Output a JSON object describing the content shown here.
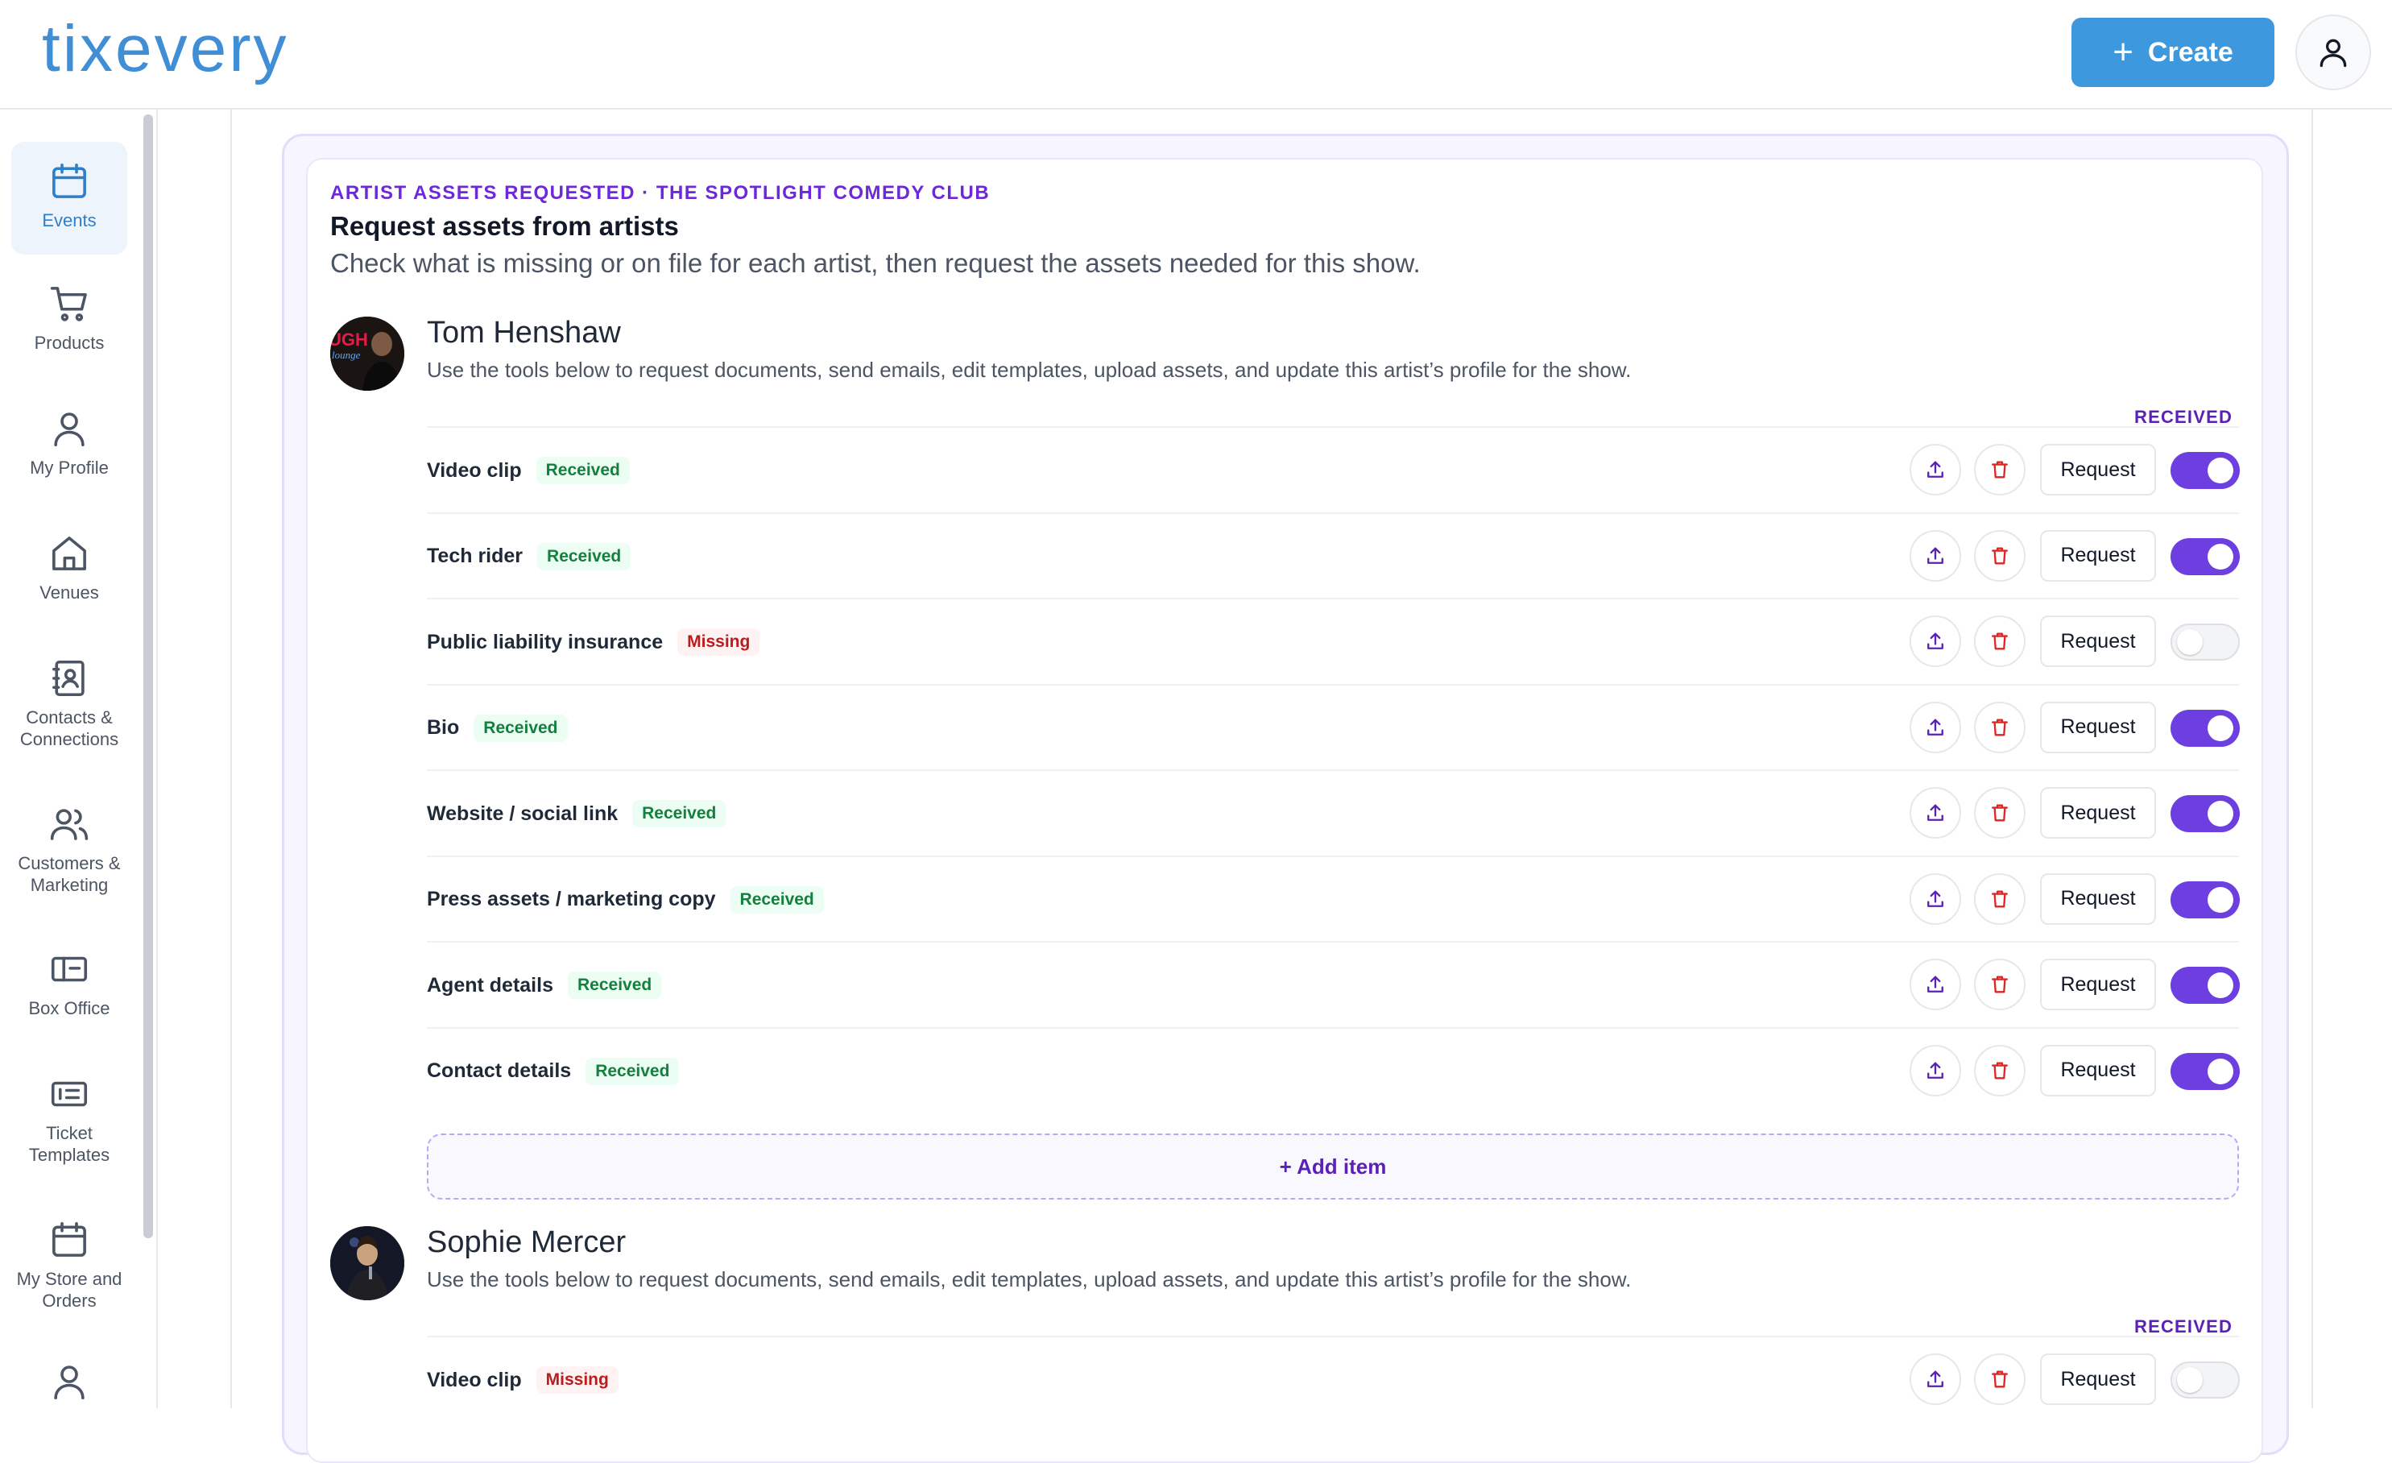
{
  "app": {
    "logo": "tixevery"
  },
  "header": {
    "create_label": "Create",
    "create_icon": "plus-icon",
    "user_icon": "user-icon"
  },
  "sidebar": {
    "items": [
      {
        "label": "Events",
        "icon": "calendar-icon",
        "active": true
      },
      {
        "label": "Products",
        "icon": "cart-icon"
      },
      {
        "label": "My Profile",
        "icon": "user-icon"
      },
      {
        "label": "Venues",
        "icon": "home-icon"
      },
      {
        "label": "Contacts & Connections",
        "icon": "contacts-icon"
      },
      {
        "label": "Customers & Marketing",
        "icon": "users-icon"
      },
      {
        "label": "Box Office",
        "icon": "box-office-icon"
      },
      {
        "label": "Ticket Templates",
        "icon": "ticket-template-icon"
      },
      {
        "label": "My Store and Orders",
        "icon": "store-icon"
      }
    ]
  },
  "panel": {
    "eyebrow": "ARTIST ASSETS REQUESTED · THE SPOTLIGHT COMEDY CLUB",
    "title": "Request assets from artists",
    "subtitle": "Check what is missing or on file for each artist, then request the assets needed for this show."
  },
  "artists": [
    {
      "name": "Tom Henshaw",
      "description": "Use the tools below to request documents, send emails, edit templates, upload assets, and update this artist’s profile for the show.",
      "received_heading": "RECEIVED",
      "assets": [
        {
          "label": "Video clip",
          "status": "Received",
          "enabled": true
        },
        {
          "label": "Tech rider",
          "status": "Received",
          "enabled": true
        },
        {
          "label": "Public liability insurance",
          "status": "Missing",
          "enabled": false
        },
        {
          "label": "Bio",
          "status": "Received",
          "enabled": true
        },
        {
          "label": "Website / social link",
          "status": "Received",
          "enabled": true
        },
        {
          "label": "Press assets / marketing copy",
          "status": "Received",
          "enabled": true
        },
        {
          "label": "Agent details",
          "status": "Received",
          "enabled": true
        },
        {
          "label": "Contact details",
          "status": "Received",
          "enabled": true
        }
      ],
      "add_item_label": "+ Add item"
    },
    {
      "name": "Sophie Mercer",
      "description": "Use the tools below to request documents, send emails, edit templates, upload assets, and update this artist’s profile for the show.",
      "received_heading": "RECEIVED",
      "assets": [
        {
          "label": "Video clip",
          "status": "Missing",
          "enabled": false
        }
      ]
    }
  ],
  "row_actions": {
    "request_label": "Request",
    "upload_icon": "upload-icon",
    "delete_icon": "trash-icon"
  },
  "colors": {
    "brand": "#3d98dd",
    "accent": "#6d3fe0",
    "received": "#15803d",
    "missing": "#b91c1c"
  }
}
